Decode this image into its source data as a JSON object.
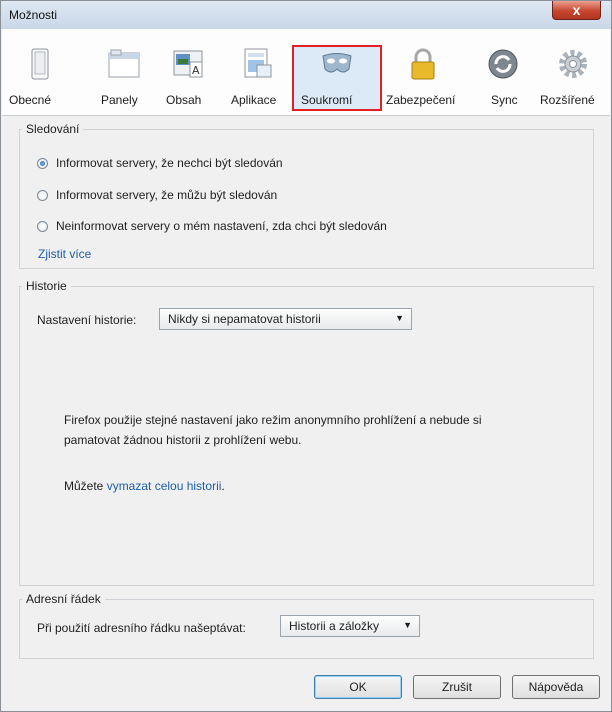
{
  "window": {
    "title": "Možnosti",
    "close_label": "x"
  },
  "toolbar": {
    "tabs": [
      {
        "label": "Obecné",
        "icon": "switch-icon"
      },
      {
        "label": "Panely",
        "icon": "tabs-icon"
      },
      {
        "label": "Obsah",
        "icon": "content-icon"
      },
      {
        "label": "Aplikace",
        "icon": "applications-icon"
      },
      {
        "label": "Soukromí",
        "icon": "mask-icon",
        "selected": true
      },
      {
        "label": "Zabezpečení",
        "icon": "lock-icon"
      },
      {
        "label": "Sync",
        "icon": "sync-icon"
      },
      {
        "label": "Rozšířené",
        "icon": "gear-icon"
      }
    ]
  },
  "tracking": {
    "title": "Sledování",
    "options": [
      {
        "label": "Informovat servery, že nechci být sledován",
        "checked": true
      },
      {
        "label": "Informovat servery, že můžu být sledován",
        "checked": false
      },
      {
        "label": "Neinformovat servery o mém nastavení, zda chci být sledován",
        "checked": false
      }
    ],
    "learn_more": "Zjistit více"
  },
  "history": {
    "title": "Historie",
    "setting_label": "Nastavení historie:",
    "setting_value": "Nikdy si nepamatovat historii",
    "info_line1": "Firefox použije stejné nastavení jako režim anonymního prohlížení a nebude si",
    "info_line2": "pamatovat žádnou historii z prohlížení webu.",
    "clear_prefix": "Můžete ",
    "clear_link": "vymazat celou historii",
    "clear_suffix": "."
  },
  "address_bar": {
    "title": "Adresní řádek",
    "suggest_label": "Při použití adresního řádku našeptávat:",
    "suggest_value": "Historii a záložky"
  },
  "buttons": {
    "ok": "OK",
    "cancel": "Zrušit",
    "help": "Nápověda"
  },
  "colors": {
    "selection_outline": "#e21f26",
    "link": "#1b5ead"
  }
}
